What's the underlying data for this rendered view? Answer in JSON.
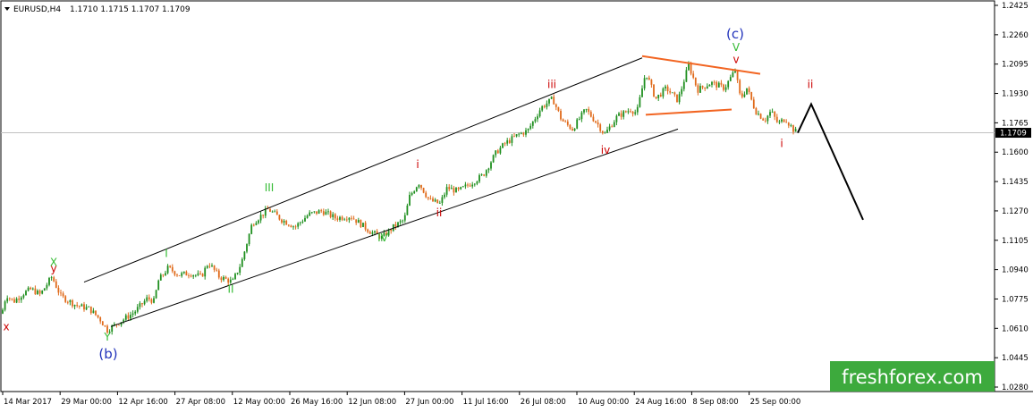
{
  "header": {
    "symbol": "EURUSD,H4",
    "quote": "1.1710 1.1715 1.1707 1.1709"
  },
  "watermark": "freshforex.com",
  "colors": {
    "bull": "#1f8f1f",
    "bear": "#e06a1a",
    "red_label": "#cc0000",
    "green_label": "#33bb33",
    "blue_label": "#2233bb",
    "triangle": "#f26522",
    "watermark_bg": "#3daa3d"
  },
  "chart_data": {
    "type": "candlestick",
    "y_ticks": [
      "1.2425",
      "1.2260",
      "1.2095",
      "1.1930",
      "1.1765",
      "1.1600",
      "1.1435",
      "1.1270",
      "1.1105",
      "1.0940",
      "1.0775",
      "1.0610",
      "1.0445",
      "1.0280"
    ],
    "ylim": [
      1.028,
      1.2425
    ],
    "x_ticks": [
      "14 Mar 2017",
      "29 Mar 00:00",
      "12 Apr 16:00",
      "27 Apr 08:00",
      "12 May 00:00",
      "26 May 16:00",
      "12 Jun 08:00",
      "27 Jun 00:00",
      "11 Jul 16:00",
      "26 Jul 08:00",
      "10 Aug 00:00",
      "24 Aug 16:00",
      "8 Sep 08:00",
      "25 Sep 00:00"
    ],
    "current_price": "1.1709",
    "price_path": [
      [
        0,
        1.065
      ],
      [
        7,
        1.08
      ],
      [
        15,
        1.076
      ],
      [
        27,
        1.081
      ],
      [
        35,
        1.083
      ],
      [
        45,
        1.08
      ],
      [
        58,
        1.09
      ],
      [
        68,
        1.079
      ],
      [
        85,
        1.074
      ],
      [
        100,
        1.072
      ],
      [
        112,
        1.066
      ],
      [
        120,
        1.06
      ],
      [
        135,
        1.065
      ],
      [
        150,
        1.07
      ],
      [
        165,
        1.078
      ],
      [
        173,
        1.076
      ],
      [
        176,
        1.087
      ],
      [
        188,
        1.095
      ],
      [
        200,
        1.091
      ],
      [
        212,
        1.092
      ],
      [
        225,
        1.09
      ],
      [
        233,
        1.098
      ],
      [
        245,
        1.09
      ],
      [
        260,
        1.087
      ],
      [
        270,
        1.098
      ],
      [
        282,
        1.12
      ],
      [
        300,
        1.128
      ],
      [
        315,
        1.122
      ],
      [
        330,
        1.118
      ],
      [
        345,
        1.125
      ],
      [
        360,
        1.127
      ],
      [
        375,
        1.123
      ],
      [
        392,
        1.124
      ],
      [
        405,
        1.119
      ],
      [
        415,
        1.115
      ],
      [
        427,
        1.112
      ],
      [
        440,
        1.118
      ],
      [
        452,
        1.122
      ],
      [
        458,
        1.135
      ],
      [
        468,
        1.143
      ],
      [
        480,
        1.133
      ],
      [
        492,
        1.131
      ],
      [
        500,
        1.14
      ],
      [
        512,
        1.138
      ],
      [
        525,
        1.142
      ],
      [
        540,
        1.147
      ],
      [
        555,
        1.16
      ],
      [
        565,
        1.165
      ],
      [
        580,
        1.17
      ],
      [
        590,
        1.172
      ],
      [
        605,
        1.185
      ],
      [
        618,
        1.19
      ],
      [
        628,
        1.178
      ],
      [
        640,
        1.173
      ],
      [
        655,
        1.184
      ],
      [
        668,
        1.176
      ],
      [
        676,
        1.17
      ],
      [
        690,
        1.18
      ],
      [
        705,
        1.184
      ],
      [
        712,
        1.182
      ],
      [
        722,
        1.205
      ],
      [
        733,
        1.19
      ],
      [
        745,
        1.196
      ],
      [
        758,
        1.189
      ],
      [
        770,
        1.209
      ],
      [
        780,
        1.195
      ],
      [
        795,
        1.199
      ],
      [
        810,
        1.196
      ],
      [
        822,
        1.206
      ],
      [
        828,
        1.19
      ],
      [
        835,
        1.196
      ],
      [
        845,
        1.183
      ],
      [
        855,
        1.178
      ],
      [
        862,
        1.183
      ],
      [
        870,
        1.176
      ],
      [
        878,
        1.179
      ],
      [
        888,
        1.172
      ],
      [
        892,
        1.1709
      ]
    ],
    "channel_upper": [
      [
        1.087,
        94
      ],
      [
        1.213,
        718
      ]
    ],
    "channel_lower": [
      [
        1.062,
        124
      ],
      [
        1.173,
        758
      ]
    ],
    "triangle_upper": [
      [
        1.214,
        718
      ],
      [
        1.204,
        850
      ]
    ],
    "triangle_lower": [
      [
        1.181,
        722
      ],
      [
        1.184,
        818
      ]
    ],
    "forecast_path": [
      [
        892,
        1.1709
      ],
      [
        907,
        1.187
      ],
      [
        965,
        1.122
      ]
    ],
    "labels": [
      {
        "text": "x",
        "color": "red_label",
        "x": 7,
        "price": 1.06
      },
      {
        "text": "X",
        "color": "green_label",
        "x": 60,
        "price": 1.096
      },
      {
        "text": "y",
        "color": "red_label",
        "x": 60,
        "price": 1.0925
      },
      {
        "text": "Y",
        "color": "green_label",
        "x": 120,
        "price": 1.054
      },
      {
        "text": "(b)",
        "color": "blue_label",
        "x": 121,
        "price": 1.044,
        "big": true
      },
      {
        "text": "I",
        "color": "green_label",
        "x": 186,
        "price": 1.101
      },
      {
        "text": "II",
        "color": "green_label",
        "x": 258,
        "price": 1.081
      },
      {
        "text": "III",
        "color": "green_label",
        "x": 301,
        "price": 1.138
      },
      {
        "text": "IV",
        "color": "green_label",
        "x": 428,
        "price": 1.11
      },
      {
        "text": "i",
        "color": "red_label",
        "x": 467,
        "price": 1.151
      },
      {
        "text": "ii",
        "color": "red_label",
        "x": 491,
        "price": 1.124
      },
      {
        "text": "iii",
        "color": "red_label",
        "x": 617,
        "price": 1.196
      },
      {
        "text": "iv",
        "color": "red_label",
        "x": 677,
        "price": 1.159
      },
      {
        "text": "(c)",
        "color": "blue_label",
        "x": 822,
        "price": 1.224,
        "big": true
      },
      {
        "text": "V",
        "color": "green_label",
        "x": 823,
        "price": 1.217
      },
      {
        "text": "v",
        "color": "red_label",
        "x": 823,
        "price": 1.21
      },
      {
        "text": "ii",
        "color": "red_label",
        "x": 906,
        "price": 1.196
      },
      {
        "text": "i",
        "color": "red_label",
        "x": 874,
        "price": 1.163
      }
    ]
  }
}
